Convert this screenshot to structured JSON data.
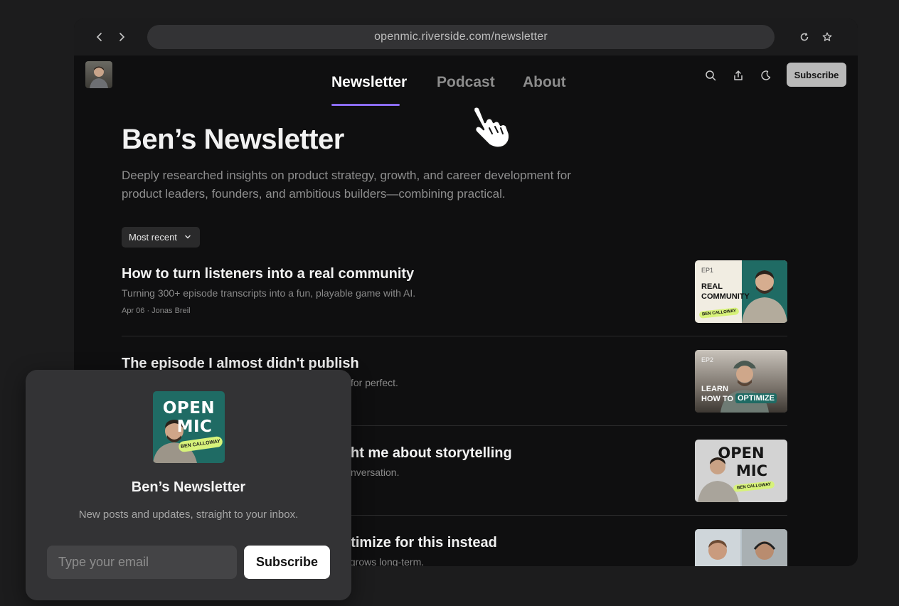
{
  "browser": {
    "url": "openmic.riverside.com/newsletter"
  },
  "nav": {
    "items": [
      {
        "label": "Newsletter",
        "active": true
      },
      {
        "label": "Podcast",
        "active": false
      },
      {
        "label": "About",
        "active": false
      }
    ]
  },
  "header": {
    "subscribe_label": "Subscribe"
  },
  "page": {
    "title": "Ben’s Newsletter",
    "description": "Deeply researched insights on product strategy, growth, and career development for product leaders, founders, and ambitious builders—combining practical.",
    "sort_label": "Most recent"
  },
  "posts": [
    {
      "title": "How to turn listeners into a real community",
      "subtitle": "Turning 300+ episode transcripts into a fun, playable game with AI.",
      "meta": "Apr 06 · Jonas Breil",
      "thumb": {
        "ep": "EP1",
        "line1": "REAL",
        "line2": "COMMUNITY",
        "tag": "BEN CALLOWAY"
      }
    },
    {
      "title": "The episode I almost didn't publish",
      "subtitle": "for perfect.",
      "meta": "",
      "thumb": {
        "ep": "EP2",
        "line1": "LEARN",
        "line2": "HOW TO",
        "highlight": "OPTIMIZE"
      }
    },
    {
      "title": "ht me about storytelling",
      "subtitle": "nversation.",
      "meta": "",
      "thumb": {
        "line1": "OPEN",
        "line2": "MIC",
        "tag": "BEN CALLOWAY"
      }
    },
    {
      "title": "otimize for this instead",
      "subtitle": "y grows long-term.",
      "meta": ""
    }
  ],
  "popup": {
    "cover_line1": "OPEN",
    "cover_line2": "MIC",
    "cover_tag": "BEN CALLOWAY",
    "title": "Ben’s Newsletter",
    "subtitle": "New posts and updates, straight to your inbox.",
    "email_placeholder": "Type your email",
    "button_label": "Subscribe"
  },
  "colors": {
    "accent": "#8b6cf2",
    "teal": "#1f6b64",
    "lime": "#d7f27a"
  },
  "icons": [
    "back-icon",
    "forward-icon",
    "reload-icon",
    "star-icon",
    "search-icon",
    "share-icon",
    "moon-icon",
    "chevron-down-icon",
    "hand-cursor-icon"
  ]
}
